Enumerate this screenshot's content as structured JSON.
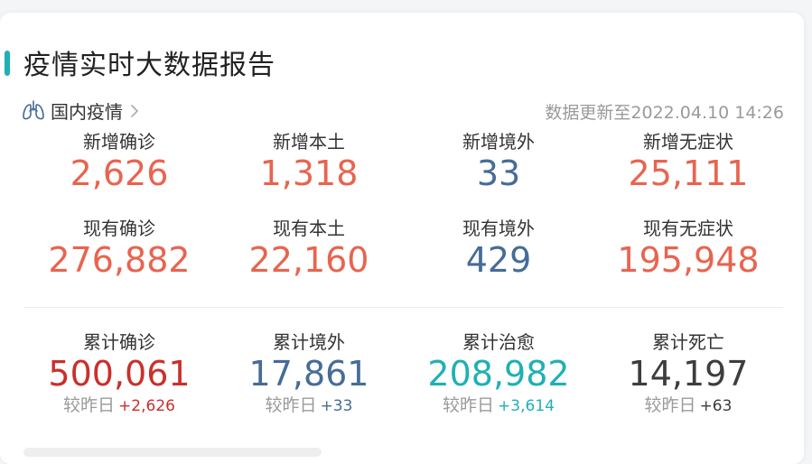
{
  "header": {
    "title": "疫情实时大数据报告"
  },
  "sub": {
    "region": "国内疫情",
    "updated": "数据更新至2022.04.10 14:26"
  },
  "colors": {
    "red": "#e8644f",
    "blue": "#466c97",
    "teal": "#1fb0b7",
    "dark_red": "#c9302c",
    "dark": "#3d3d3d",
    "accent_bar": "#1fb0b7"
  },
  "row1": [
    {
      "label": "新增确诊",
      "value": "2,626",
      "color": "#e8644f"
    },
    {
      "label": "新增本土",
      "value": "1,318",
      "color": "#e8644f"
    },
    {
      "label": "新增境外",
      "value": "33",
      "color": "#466c97"
    },
    {
      "label": "新增无症状",
      "value": "25,111",
      "color": "#e8644f"
    }
  ],
  "row2": [
    {
      "label": "现有确诊",
      "value": "276,882",
      "color": "#e8644f"
    },
    {
      "label": "现有本土",
      "value": "22,160",
      "color": "#e8644f"
    },
    {
      "label": "现有境外",
      "value": "429",
      "color": "#466c97"
    },
    {
      "label": "现有无症状",
      "value": "195,948",
      "color": "#e8644f"
    }
  ],
  "row3": [
    {
      "label": "累计确诊",
      "value": "500,061",
      "color": "#c9302c",
      "delta_label": "较昨日",
      "delta": "+2,626",
      "delta_color": "#c9302c"
    },
    {
      "label": "累计境外",
      "value": "17,861",
      "color": "#466c97",
      "delta_label": "较昨日",
      "delta": "+33",
      "delta_color": "#466c97"
    },
    {
      "label": "累计治愈",
      "value": "208,982",
      "color": "#1fb0b7",
      "delta_label": "较昨日",
      "delta": "+3,614",
      "delta_color": "#1fb0b7"
    },
    {
      "label": "累计死亡",
      "value": "14,197",
      "color": "#3d3d3d",
      "delta_label": "较昨日",
      "delta": "+63",
      "delta_color": "#3d3d3d"
    }
  ],
  "icons": {
    "region_icon": "lungs-icon",
    "chevron": "chevron-right-icon"
  }
}
